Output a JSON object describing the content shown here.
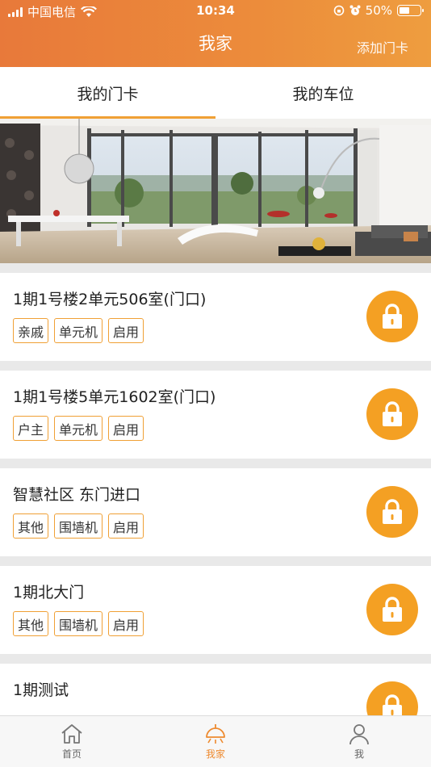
{
  "status_bar": {
    "carrier": "中国电信",
    "time": "10:34",
    "battery_percent": "50%",
    "battery_level": 0.5
  },
  "header": {
    "title": "我家",
    "action_label": "添加门卡"
  },
  "tabs": [
    {
      "label": "我的门卡",
      "active": true
    },
    {
      "label": "我的车位",
      "active": false
    }
  ],
  "cards": [
    {
      "name": "1期1号楼2单元506室(门口)",
      "tags": [
        "亲戚",
        "单元机",
        "启用"
      ]
    },
    {
      "name": "1期1号楼5单元1602室(门口)",
      "tags": [
        "户主",
        "单元机",
        "启用"
      ]
    },
    {
      "name": "智慧社区 东门进口",
      "tags": [
        "其他",
        "围墙机",
        "启用"
      ]
    },
    {
      "name": "1期北大门",
      "tags": [
        "其他",
        "围墙机",
        "启用"
      ]
    },
    {
      "name": "1期测试",
      "tags": []
    }
  ],
  "tabbar": [
    {
      "label": "首页",
      "icon": "home-icon",
      "active": false
    },
    {
      "label": "我家",
      "icon": "lamp-icon",
      "active": true
    },
    {
      "label": "我",
      "icon": "person-icon",
      "active": false
    }
  ],
  "colors": {
    "accent": "#f4a023",
    "header_start": "#e8793a",
    "header_end": "#ee9d3f",
    "active_tab": "#ee8a2f"
  }
}
